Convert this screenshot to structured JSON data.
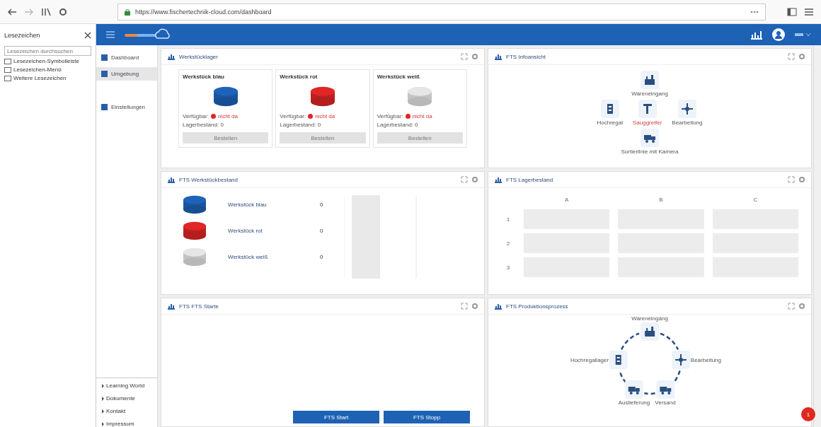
{
  "browser": {
    "url": "https://www.fischertechnik-cloud.com/dashboard",
    "bookmarks": {
      "title": "Lesezeichen",
      "search_placeholder": "Lesezeichen durchsuchen",
      "items": [
        {
          "label": "Lesezeichen-Symbolleiste"
        },
        {
          "label": "Lesezeichen-Menü"
        },
        {
          "label": "Weitere Lesezeichen"
        }
      ]
    }
  },
  "sidebar": {
    "items": [
      {
        "label": "Dashboard",
        "selected": false
      },
      {
        "label": "Umgebung",
        "selected": true
      },
      {
        "label": "Einstellungen",
        "selected": false
      }
    ],
    "footer_items": [
      "Learning World",
      "Dokumente",
      "Kontakt",
      "Impressum"
    ]
  },
  "panels": [
    {
      "kind": "stock",
      "title": "Werkstücklager",
      "cards": [
        {
          "title": "Werkstück blau",
          "color": "#1e63b8",
          "status_label": "Verfügbar:",
          "status": "nicht da",
          "count_label": "Lagerbestand: 0",
          "button": "Bestellen"
        },
        {
          "title": "Werkstück rot",
          "color": "#e02626",
          "status_label": "Verfügbar:",
          "status": "nicht da",
          "count_label": "Lagerbestand: 0",
          "button": "Bestellen"
        },
        {
          "title": "Werkstück weiß",
          "color": "#e6e6e6",
          "status_label": "Verfügbar:",
          "status": "nicht da",
          "count_label": "Lagerbestand: 0",
          "button": "Bestellen"
        }
      ]
    },
    {
      "kind": "overview",
      "title": "FTS Infoansicht",
      "rows": [
        [
          {
            "label": "Wareneingang",
            "highlight": false
          }
        ],
        [
          {
            "label": "Hochregal",
            "highlight": false
          },
          {
            "label": "Sauggreifer",
            "highlight": true
          },
          {
            "label": "Bearbeitung",
            "highlight": false
          }
        ],
        [
          {
            "label": "Sortierlinie mit Kamera",
            "highlight": false
          }
        ]
      ]
    },
    {
      "kind": "stock_list",
      "title": "FTS Werkstückbestand",
      "items": [
        {
          "name": "Werkstück blau",
          "color": "#1e63b8",
          "count": "0"
        },
        {
          "name": "Werkstück rot",
          "color": "#e02626",
          "count": "0"
        },
        {
          "name": "Werkstück weiß",
          "color": "#e6e6e6",
          "count": "0"
        }
      ]
    },
    {
      "kind": "storage_grid",
      "title": "FTS Lagerbestand",
      "columns": [
        "A",
        "B",
        "C"
      ],
      "rows": [
        "1",
        "2",
        "3"
      ]
    },
    {
      "kind": "controls",
      "title": "FTS FTS Starte",
      "buttons": [
        "FTS Start",
        "FTS Stopp"
      ]
    },
    {
      "kind": "process",
      "title": "FTS Produktionsprozess",
      "nodes": [
        {
          "label": "Wareneingang"
        },
        {
          "label": "Bearbeitung"
        },
        {
          "label": "Versand"
        },
        {
          "label": "Auslieferung"
        },
        {
          "label": "Hochregallager"
        }
      ]
    }
  ],
  "notifications": "1"
}
